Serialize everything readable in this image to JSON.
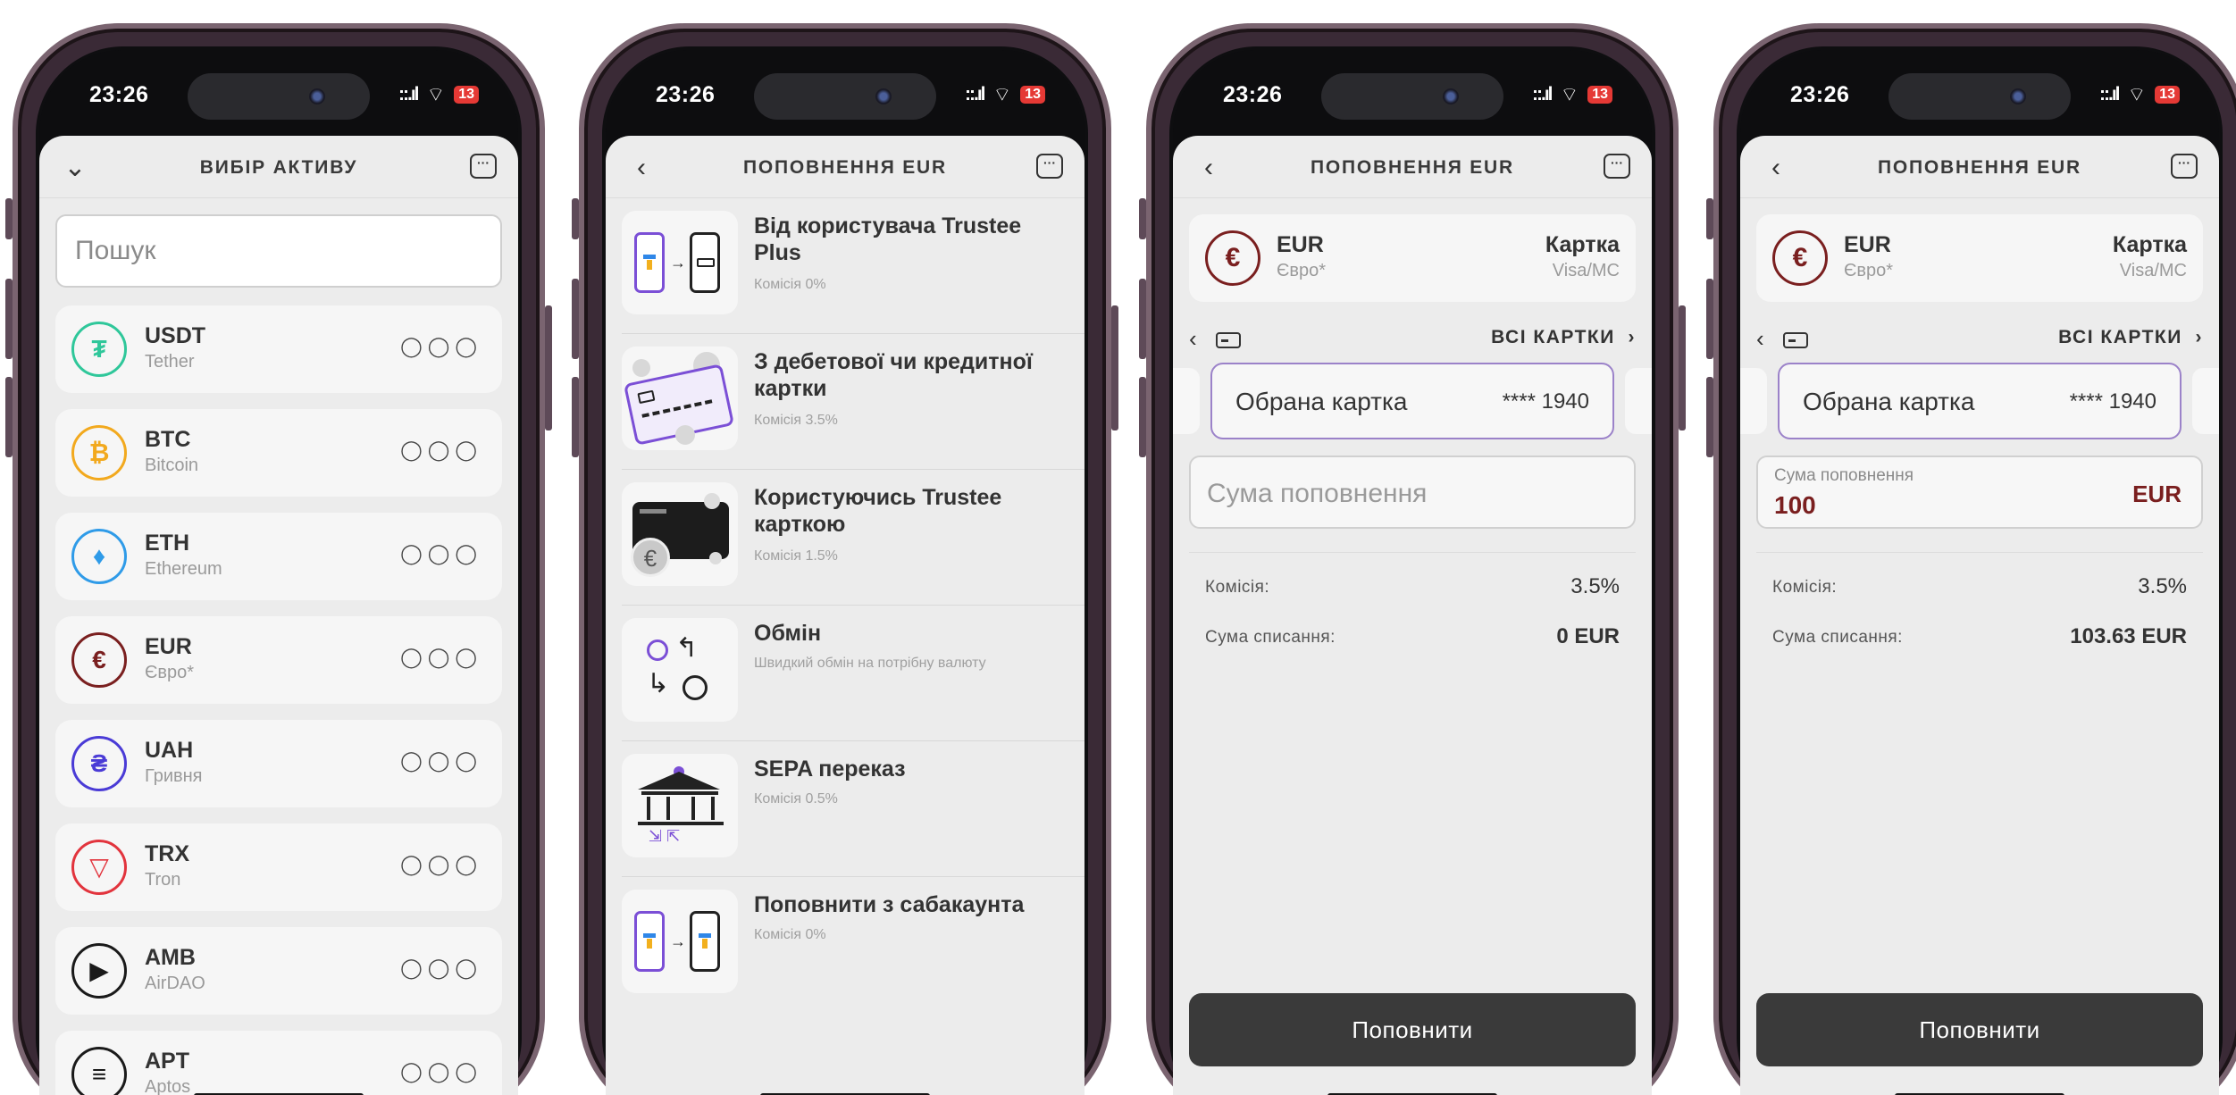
{
  "status": {
    "time": "23:26",
    "signal": "::.ıl",
    "wifi": "ᯤ",
    "battery": "13"
  },
  "screen1": {
    "title": "ВИБІР АКТИВУ",
    "search_placeholder": "Пошук",
    "assets": [
      {
        "ticker": "USDT",
        "name": "Tether",
        "icon": "tether-icon",
        "glyph": "₮",
        "color": "#2fc79a"
      },
      {
        "ticker": "BTC",
        "name": "Bitcoin",
        "icon": "bitcoin-icon",
        "glyph": "₿",
        "color": "#f2a91e"
      },
      {
        "ticker": "ETH",
        "name": "Ethereum",
        "icon": "ethereum-icon",
        "glyph": "♦",
        "color": "#2f9be8"
      },
      {
        "ticker": "EUR",
        "name": "Євро*",
        "icon": "euro-icon",
        "glyph": "€",
        "color": "#7a1f1f"
      },
      {
        "ticker": "UAH",
        "name": "Гривня",
        "icon": "hryvnia-icon",
        "glyph": "₴",
        "color": "#4a3bd6"
      },
      {
        "ticker": "TRX",
        "name": "Tron",
        "icon": "tron-icon",
        "glyph": "▽",
        "color": "#e2343d"
      },
      {
        "ticker": "AMB",
        "name": "AirDAO",
        "icon": "airdao-icon",
        "glyph": "▶",
        "color": "#1a1a1a"
      },
      {
        "ticker": "APT",
        "name": "Aptos",
        "icon": "aptos-icon",
        "glyph": "≡",
        "color": "#1a1a1a"
      }
    ],
    "shields": "◯◯◯"
  },
  "screen2": {
    "title": "ПОПОВНЕННЯ EUR",
    "methods": [
      {
        "title": "Від користувача Trustee Plus",
        "sub": "Комісія 0%"
      },
      {
        "title": "З дебетової чи кредитної картки",
        "sub": "Комісія 3.5%"
      },
      {
        "title": "Користуючись Trustee карткою",
        "sub": "Комісія 1.5%"
      },
      {
        "title": "Обмін",
        "sub": "Швидкий обмін на потрібну валюту"
      },
      {
        "title": "SEPA переказ",
        "sub": "Комісія 0.5%"
      },
      {
        "title": "Поповнити з сабакаунта",
        "sub": "Комісія 0%"
      }
    ]
  },
  "screen3": {
    "title": "ПОПОВНЕННЯ EUR",
    "currency": {
      "ticker": "EUR",
      "name": "Євро*",
      "method": "Картка",
      "method_sub": "Visa/MC"
    },
    "all_cards": "ВСІ КАРТКИ",
    "selected_card_label": "Обрана картка",
    "selected_card_number": "**** 1940",
    "amount_placeholder": "Сума поповнення",
    "fee_label": "Комісія:",
    "fee_value": "3.5%",
    "debit_label": "Сума списання:",
    "debit_value": "0 EUR",
    "submit": "Поповнити"
  },
  "screen4": {
    "title": "ПОПОВНЕННЯ EUR",
    "currency": {
      "ticker": "EUR",
      "name": "Євро*",
      "method": "Картка",
      "method_sub": "Visa/MC"
    },
    "all_cards": "ВСІ КАРТКИ",
    "selected_card_label": "Обрана картка",
    "selected_card_number": "**** 1940",
    "amount_label": "Сума поповнення",
    "amount_value": "100",
    "amount_currency": "EUR",
    "fee_label": "Комісія:",
    "fee_value": "3.5%",
    "debit_label": "Сума списання:",
    "debit_value": "103.63 EUR",
    "submit": "Поповнити"
  }
}
